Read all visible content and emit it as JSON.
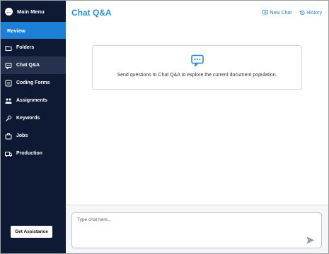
{
  "sidebar": {
    "main_menu_label": "Main Menu",
    "section_label": "Review",
    "items": [
      {
        "label": "Folders",
        "icon": "folder-icon"
      },
      {
        "label": "Chat Q&A",
        "icon": "chat-icon",
        "active": true
      },
      {
        "label": "Coding Forms",
        "icon": "coding-forms-icon"
      },
      {
        "label": "Assignments",
        "icon": "assignments-icon"
      },
      {
        "label": "Keywords",
        "icon": "key-icon"
      },
      {
        "label": "Jobs",
        "icon": "jobs-icon"
      },
      {
        "label": "Production",
        "icon": "production-icon"
      }
    ],
    "assist_label": "Get Assistance"
  },
  "header": {
    "title": "Chat Q&A",
    "new_chat_label": "New Chat",
    "history_label": "History"
  },
  "empty_state": {
    "icon": "chat-bubble-icon",
    "message": "Send questions to Chat Q&A to explore the current document population."
  },
  "composer": {
    "placeholder": "Type chat here..."
  },
  "colors": {
    "sidebar_bg": "#0e1a33",
    "accent": "#1e7fd6",
    "title": "#2b8fd8"
  }
}
